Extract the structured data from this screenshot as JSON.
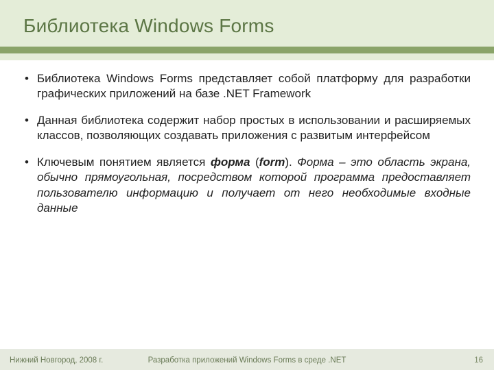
{
  "title": "Библиотека Windows Forms",
  "bullets": {
    "b1": "Библиотека Windows Forms представляет собой платформу для разработки графических приложений на базе .NET Framework",
    "b2": "Данная библиотека содержит набор простых в использовании и расширяемых классов, позволяющих создавать приложения с развитым интерфейсом",
    "b3_lead": "Ключевым понятием является ",
    "b3_bold1": "форма",
    "b3_paren_open": " (",
    "b3_bold2": "form",
    "b3_paren_close": "). ",
    "b3_tail": "Форма – это область экрана, обычно прямоугольная, посредством которой программа предоставляет пользователю информацию и получает от него необходимые входные данные"
  },
  "footer": {
    "left": "Нижний Новгород, 2008 г.",
    "center": "Разработка приложений Windows Forms в среде .NET",
    "page": "16"
  }
}
